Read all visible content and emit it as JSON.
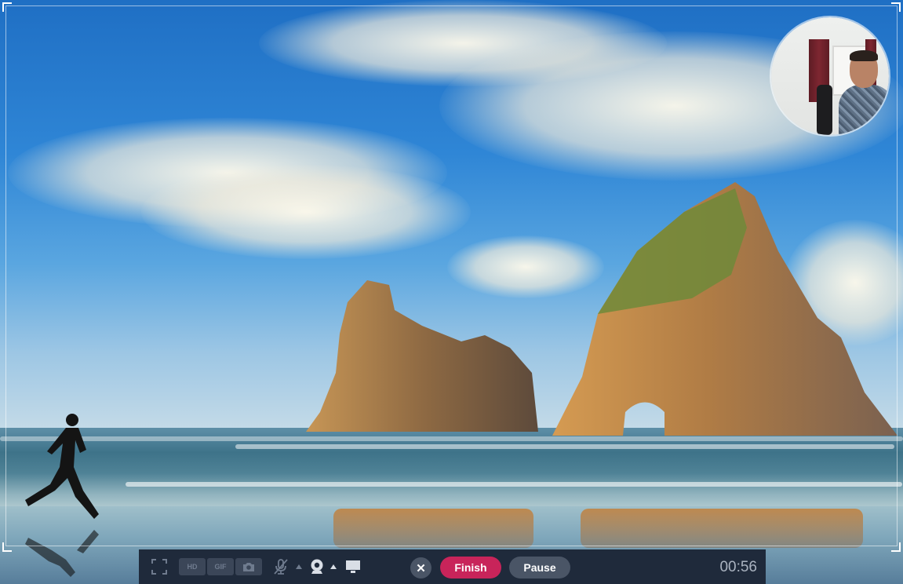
{
  "toolbar": {
    "fullscreen_icon": "fullscreen-icon",
    "hd_label": "HD",
    "gif_label": "GIF",
    "camera_icon": "camera-icon",
    "mic_icon": "mic-muted-icon",
    "webcam_icon": "webcam-icon",
    "screen_icon": "monitor-icon",
    "cancel_label": "✕",
    "finish_label": "Finish",
    "pause_label": "Pause",
    "timer": "00:56"
  },
  "colors": {
    "toolbar_bg": "#1f2a3b",
    "finish_accent": "#c8245a",
    "secondary_button": "#4a5566"
  }
}
